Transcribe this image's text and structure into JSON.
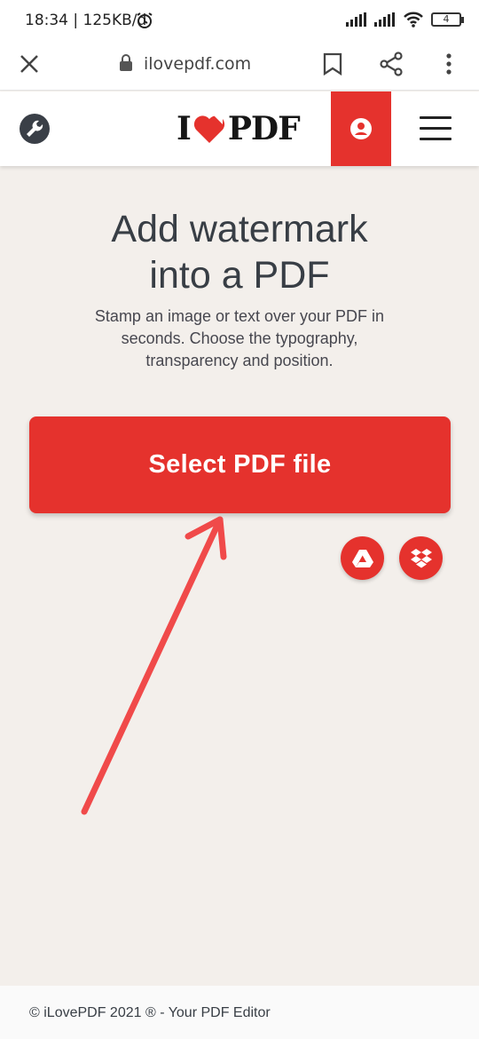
{
  "status_bar": {
    "time_speed": "18:34 | 125KB/d",
    "battery": "4"
  },
  "browser": {
    "url": "ilovepdf.com"
  },
  "header": {
    "logo_left": "I",
    "logo_right": "PDF"
  },
  "main": {
    "title_line1": "Add watermark",
    "title_line2": "into a PDF",
    "subtitle_line1": "Stamp an image or text over your PDF in",
    "subtitle_line2": "seconds. Choose the typography,",
    "subtitle_line3": "transparency and position.",
    "select_button": "Select PDF file"
  },
  "footer": {
    "text": "© iLovePDF 2021 ® - Your PDF Editor"
  },
  "colors": {
    "brand_red": "#e5322d",
    "background": "#f3efeb",
    "arrow": "#f04a4a"
  }
}
